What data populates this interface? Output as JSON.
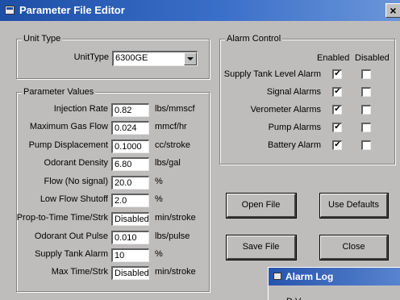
{
  "window": {
    "title": "Parameter File Editor",
    "close_label": "×"
  },
  "unit_type": {
    "legend": "Unit Type",
    "label": "UnitType",
    "selected": "6300GE"
  },
  "parameters": {
    "legend": "Parameter Values",
    "rows": [
      {
        "label": "Injection Rate",
        "value": "0.82",
        "unit": "lbs/mmscf"
      },
      {
        "label": "Maximum Gas Flow",
        "value": "0.024",
        "unit": "mmcf/hr"
      },
      {
        "label": "Pump Displacement",
        "value": "0.1000",
        "unit": "cc/stroke"
      },
      {
        "label": "Odorant Density",
        "value": "6.80",
        "unit": "lbs/gal"
      },
      {
        "label": "Flow (No signal)",
        "value": "20.0",
        "unit": "%"
      },
      {
        "label": "Low Flow Shutoff",
        "value": "2.0",
        "unit": "%"
      },
      {
        "label": "Prop-to-Time Time/Strk",
        "value": "Disabled",
        "unit": "min/stroke"
      },
      {
        "label": "Odorant Out Pulse",
        "value": "0.010",
        "unit": "lbs/pulse"
      },
      {
        "label": "Supply Tank Alarm",
        "value": "10",
        "unit": "%"
      },
      {
        "label": "Max Time/Strk",
        "value": "Disabled",
        "unit": "min/stroke"
      }
    ]
  },
  "alarm_control": {
    "legend": "Alarm Control",
    "col_enabled": "Enabled",
    "col_disabled": "Disabled",
    "check_mark": "✔",
    "rows": [
      {
        "label": "Supply Tank Level Alarm",
        "enabled": true,
        "disabled": false
      },
      {
        "label": "Signal Alarms",
        "enabled": true,
        "disabled": false
      },
      {
        "label": "Verometer Alarms",
        "enabled": true,
        "disabled": false
      },
      {
        "label": "Pump Alarms",
        "enabled": true,
        "disabled": false
      },
      {
        "label": "Battery Alarm",
        "enabled": true,
        "disabled": false
      }
    ]
  },
  "buttons": {
    "open_file": "Open File",
    "use_defaults": "Use Defaults",
    "save_file": "Save File",
    "close": "Close"
  },
  "alarm_log": {
    "title": "Alarm Log",
    "partial_text": "D    V"
  }
}
